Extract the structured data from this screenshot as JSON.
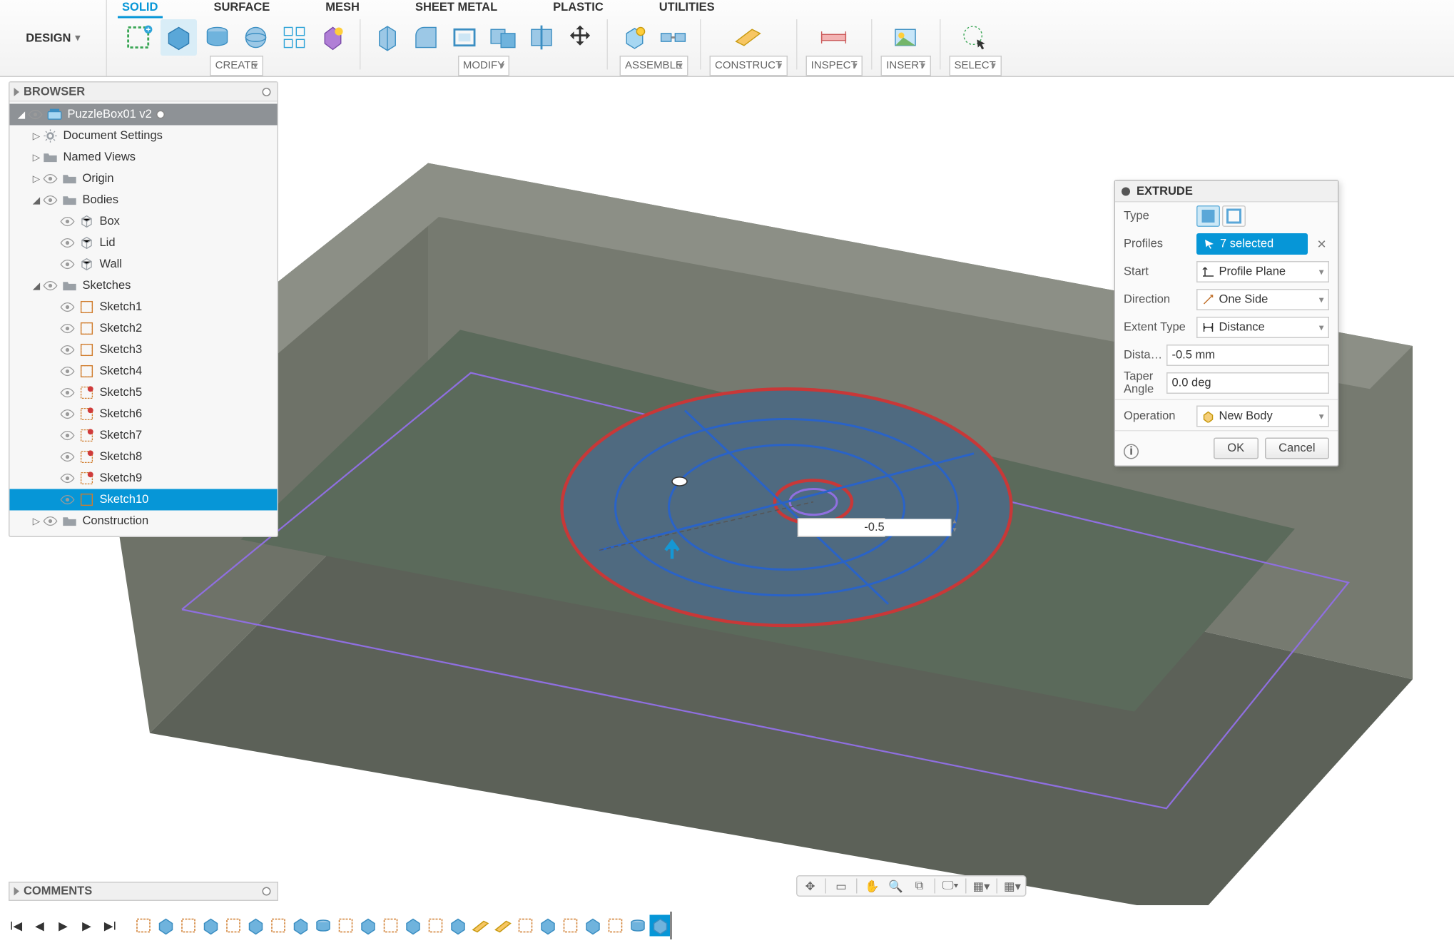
{
  "workspace": "DESIGN",
  "ribbon": {
    "tabs": [
      "SOLID",
      "SURFACE",
      "MESH",
      "SHEET METAL",
      "PLASTIC",
      "UTILITIES"
    ],
    "active_tab": 0,
    "groups": {
      "create": "CREATE",
      "modify": "MODIFY",
      "assemble": "ASSEMBLE",
      "construct": "CONSTRUCT",
      "inspect": "INSPECT",
      "insert": "INSERT",
      "select": "SELECT"
    }
  },
  "browser": {
    "title": "BROWSER",
    "root": "PuzzleBox01 v2",
    "nodes": {
      "doc_settings": "Document Settings",
      "named_views": "Named Views",
      "origin": "Origin",
      "bodies": "Bodies",
      "body_items": [
        "Box",
        "Lid",
        "Wall"
      ],
      "sketches": "Sketches",
      "sketch_items": [
        "Sketch1",
        "Sketch2",
        "Sketch3",
        "Sketch4",
        "Sketch5",
        "Sketch6",
        "Sketch7",
        "Sketch8",
        "Sketch9",
        "Sketch10"
      ],
      "construction": "Construction"
    },
    "selected_sketch_index": 9
  },
  "comments_title": "COMMENTS",
  "extrude": {
    "title": "EXTRUDE",
    "type_label": "Type",
    "profiles_label": "Profiles",
    "profiles_value": "7 selected",
    "start_label": "Start",
    "start_value": "Profile Plane",
    "direction_label": "Direction",
    "direction_value": "One Side",
    "extent_label": "Extent Type",
    "extent_value": "Distance",
    "distance_label": "Distance",
    "distance_value": "-0.5 mm",
    "taper_label": "Taper Angle",
    "taper_value": "0.0 deg",
    "operation_label": "Operation",
    "operation_value": "New Body",
    "ok": "OK",
    "cancel": "Cancel"
  },
  "canvas_dim": "-0.5",
  "timeline_count": 24
}
